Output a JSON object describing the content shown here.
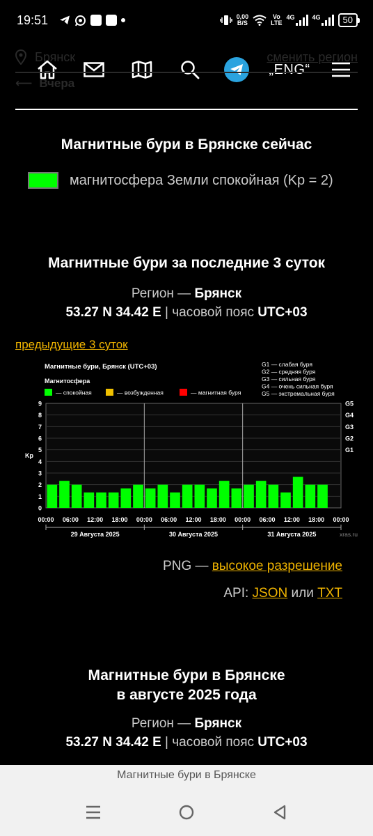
{
  "status_bar": {
    "time": "19:51",
    "net_speed_value": "0,00",
    "net_speed_unit": "B/S",
    "volte_top": "Vo",
    "volte_bottom": "LTE",
    "sig1_label": "4G",
    "sig2_label": "4G",
    "battery": "50"
  },
  "header_bg": {
    "city": "Брянск",
    "change_region": "сменить регион",
    "back_label": "Вчера"
  },
  "nav": {
    "lang": "„ENG“"
  },
  "now_section": {
    "title": "Магнитные бури в Брянске сейчас",
    "status_text": "магнитосфера Земли спокойная (Kp = 2)",
    "status_color": "#00ff00"
  },
  "three_days": {
    "title": "Магнитные бури за последние 3 суток",
    "region_label": "Регион — ",
    "region_value": "Брянск",
    "coords": "53.27 N 34.42 E",
    "tz_label": " | часовой пояс ",
    "tz_value": "UTC+03",
    "prev_link": "предыдущие 3 суток",
    "png_label": "PNG — ",
    "png_link": "высокое разрешение",
    "api_label": "API: ",
    "api_json": "JSON",
    "api_or": " или ",
    "api_txt": "TXT"
  },
  "chart_data": {
    "type": "bar",
    "title": "Магнитные бури, Брянск (UTC+03)",
    "legend_title": "Магнитосфера",
    "legend": [
      {
        "label": "— спокойная",
        "color": "#00ff00"
      },
      {
        "label": "— возбужденная",
        "color": "#f0c000"
      },
      {
        "label": "— магнитная буря",
        "color": "#ff0000"
      }
    ],
    "g_legend": [
      "G1 — слабая буря",
      "G2 — средняя буря",
      "G3 — сильная буря",
      "G4 — очень сильная буря",
      "G5 — экстремальная буря"
    ],
    "ylabel": "Kp",
    "ylim": [
      0,
      9
    ],
    "yticks": [
      0,
      1,
      2,
      3,
      4,
      5,
      6,
      7,
      8,
      9
    ],
    "g_levels": [
      {
        "label": "G1",
        "kp": 5
      },
      {
        "label": "G2",
        "kp": 6
      },
      {
        "label": "G3",
        "kp": 7
      },
      {
        "label": "G4",
        "kp": 8
      },
      {
        "label": "G5",
        "kp": 9
      }
    ],
    "xticks": [
      "00:00",
      "06:00",
      "12:00",
      "18:00",
      "00:00",
      "06:00",
      "12:00",
      "18:00",
      "00:00",
      "06:00",
      "12:00",
      "18:00",
      "00:00"
    ],
    "days": [
      "29 Августа 2025",
      "30 Августа 2025",
      "31 Августа 2025"
    ],
    "values": [
      2.0,
      2.33,
      2.0,
      1.33,
      1.33,
      1.33,
      1.67,
      2.0,
      1.67,
      2.0,
      1.33,
      2.0,
      2.0,
      1.67,
      2.33,
      1.67,
      2.0,
      2.33,
      2.0,
      1.33,
      2.67,
      2.0,
      2.0,
      null
    ],
    "source": "xras.ru"
  },
  "august_section": {
    "title_line1": "Магнитные бури в Брянске",
    "title_line2": "в августе 2025 года",
    "region_label": "Регион — ",
    "region_value": "Брянск",
    "coords": "53.27 N 34.42 E",
    "tz_label": " | часовой пояс ",
    "tz_value": "UTC+03"
  },
  "browser": {
    "page_title": "Магнитные бури в Брянске"
  }
}
